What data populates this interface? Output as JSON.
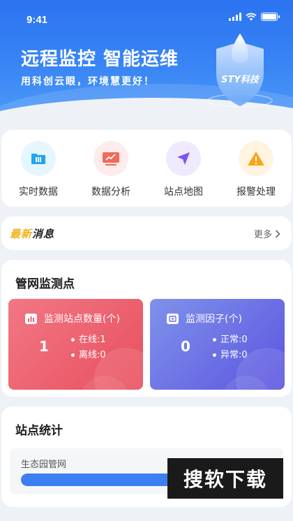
{
  "status_bar": {
    "time": "9:41"
  },
  "banner": {
    "title": "远程监控 智能运维",
    "subtitle": "用科创云眼，环境慧更好！",
    "logo_text": "STY科技"
  },
  "quick_actions": [
    {
      "label": "实时数据",
      "icon": "folder-icon",
      "bg": "#e6f6ff",
      "color": "#1ea8ee"
    },
    {
      "label": "数据分析",
      "icon": "monitor-chart-icon",
      "bg": "#fdeceb",
      "color": "#f06a5a"
    },
    {
      "label": "站点地图",
      "icon": "navigation-arrow-icon",
      "bg": "#efeafd",
      "color": "#7a55ee"
    },
    {
      "label": "报警处理",
      "icon": "warning-icon",
      "bg": "#fff4e0",
      "color": "#f7a51b"
    }
  ],
  "news": {
    "tag_part1": "最新",
    "tag_part2": "消息",
    "more": "更多"
  },
  "pipe_monitor": {
    "title": "管网监测点",
    "stations": {
      "title": "监测站点数量(个)",
      "total": "1",
      "online": "在线:1",
      "offline": "离线:0",
      "gradient": [
        "#f27784",
        "#e8505f"
      ]
    },
    "factors": {
      "title": "监测因子(个)",
      "total": "0",
      "normal": "正常:0",
      "abnormal": "异常:0",
      "gradient": [
        "#7f92ea",
        "#5c55e0"
      ]
    }
  },
  "site_stats": {
    "title": "站点统计",
    "items": [
      {
        "name": "生态园管网",
        "progress": 0.75
      }
    ]
  },
  "watermark": "搜软下载"
}
